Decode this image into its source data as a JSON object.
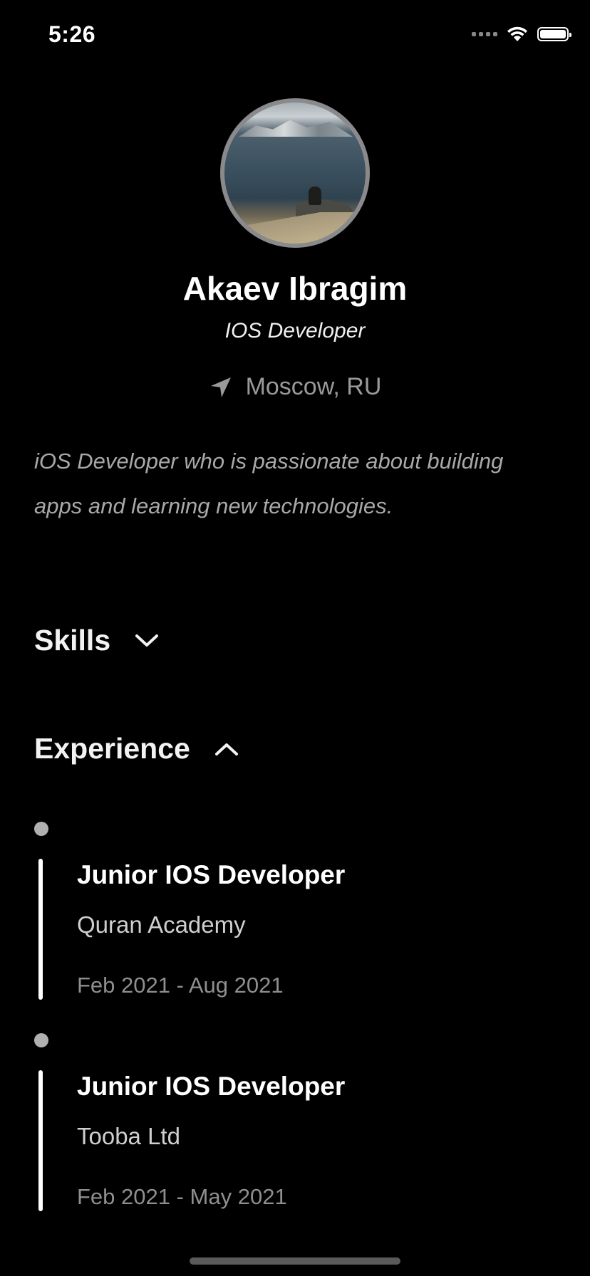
{
  "status_bar": {
    "time": "5:26"
  },
  "profile": {
    "name": "Akaev Ibragim",
    "role": "IOS Developer",
    "location": "Moscow, RU",
    "bio": "iOS Developer who is passionate about building apps and learning new technologies."
  },
  "sections": {
    "skills_label": "Skills",
    "skills_expanded": false,
    "experience_label": "Experience",
    "experience_expanded": true
  },
  "experience": [
    {
      "title": "Junior IOS Developer",
      "company": "Quran Academy",
      "dates": "Feb 2021 - Aug 2021"
    },
    {
      "title": "Junior IOS Developer",
      "company": "Tooba Ltd",
      "dates": "Feb 2021 - May 2021"
    }
  ],
  "colors": {
    "background": "#000000",
    "text": "#ffffff",
    "muted": "#9a9a9a",
    "timeline_dot": "#b0b0b0"
  }
}
